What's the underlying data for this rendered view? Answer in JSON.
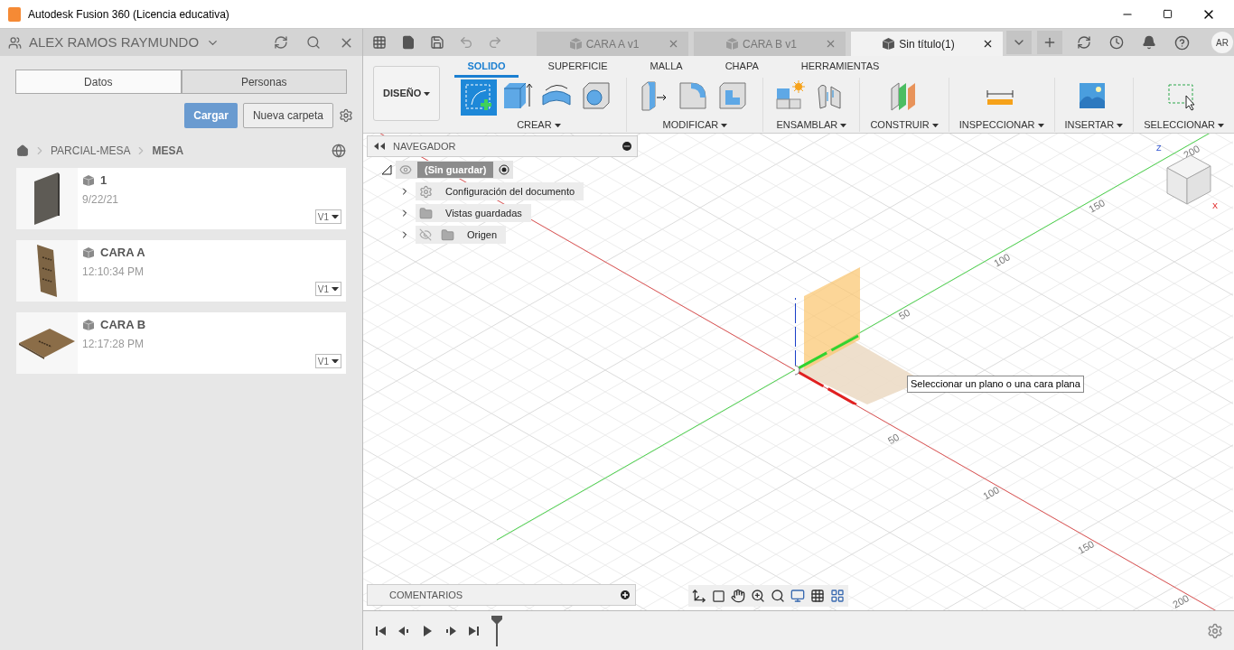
{
  "window": {
    "title": "Autodesk Fusion 360 (Licencia educativa)"
  },
  "data_panel": {
    "user": "ALEX RAMOS RAYMUNDO",
    "tabs": [
      {
        "label": "Datos",
        "selected": true
      },
      {
        "label": "Personas",
        "selected": false
      }
    ],
    "upload_button": "Cargar",
    "new_folder_button": "Nueva carpeta",
    "breadcrumb": [
      "PARCIAL-MESA",
      "MESA"
    ],
    "files": [
      {
        "name": "1",
        "date": "9/22/21",
        "version": "V1",
        "kind": "panel"
      },
      {
        "name": "CARA A",
        "date": "12:10:34 PM",
        "version": "V1",
        "kind": "board"
      },
      {
        "name": "CARA B",
        "date": "12:17:28 PM",
        "version": "V1",
        "kind": "plate"
      }
    ]
  },
  "documents": [
    {
      "label": "CARA A v1",
      "selected": false
    },
    {
      "label": "CARA B v1",
      "selected": false
    },
    {
      "label": "Sin título(1)",
      "selected": true
    }
  ],
  "avatar": "AR",
  "ribbon": {
    "workspace": "DISEÑO",
    "tabs": [
      {
        "label": "SOLIDO",
        "selected": true
      },
      {
        "label": "SUPERFICIE",
        "selected": false
      },
      {
        "label": "MALLA",
        "selected": false
      },
      {
        "label": "CHAPA",
        "selected": false
      },
      {
        "label": "HERRAMIENTAS",
        "selected": false
      }
    ],
    "groups": [
      {
        "label": "CREAR",
        "kind": "create"
      },
      {
        "label": "MODIFICAR",
        "kind": "modify"
      },
      {
        "label": "ENSAMBLAR",
        "kind": "assemble"
      },
      {
        "label": "CONSTRUIR",
        "kind": "construct"
      },
      {
        "label": "INSPECCIONAR",
        "kind": "inspect"
      },
      {
        "label": "INSERTAR",
        "kind": "insert"
      },
      {
        "label": "SELECCIONAR",
        "kind": "select"
      }
    ]
  },
  "navigator": {
    "title": "NAVEGADOR",
    "root": "(Sin guardar)",
    "items": [
      {
        "label": "Configuración del documento",
        "kind": "settings"
      },
      {
        "label": "Vistas guardadas",
        "kind": "folder"
      },
      {
        "label": "Origen",
        "kind": "hidden-folder"
      }
    ]
  },
  "comments": {
    "title": "COMENTARIOS"
  },
  "viewport": {
    "tooltip": "Seleccionar un plano o una cara plana",
    "green_axis_labels": [
      "50",
      "100",
      "150",
      "200"
    ],
    "red_axis_labels": [
      "50",
      "100",
      "150",
      "200"
    ],
    "cube_axes": [
      "Z",
      "X"
    ]
  }
}
